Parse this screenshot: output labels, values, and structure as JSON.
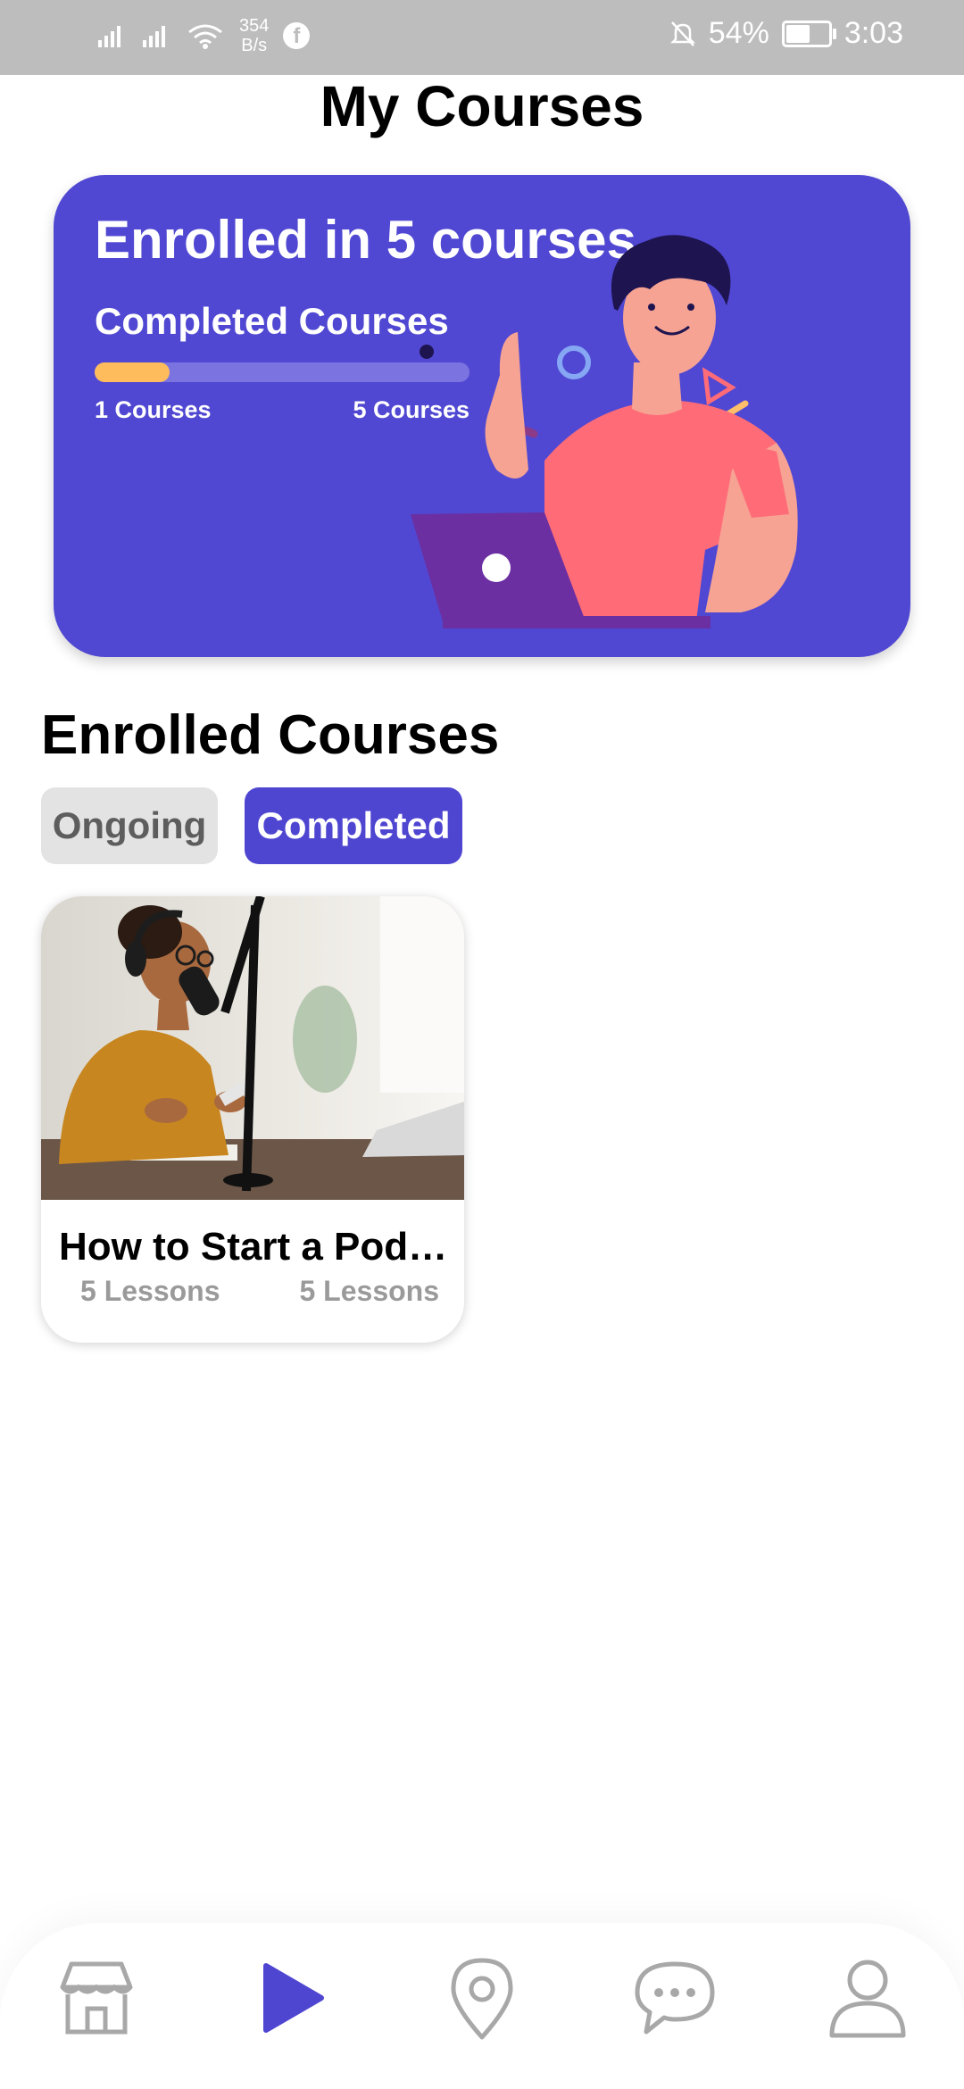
{
  "status_bar": {
    "net_speed_value": "354",
    "net_speed_unit": "B/s",
    "battery": "54%",
    "time": "3:03"
  },
  "page": {
    "title": "My Courses"
  },
  "hero": {
    "title": "Enrolled in 5 courses",
    "subtitle": "Completed Courses",
    "progress_fraction": 0.2,
    "progress_left_label": "1  Courses",
    "progress_right_label": "5 Courses",
    "accent": "#5048d2",
    "progress_color": "#ffbc5c"
  },
  "enrolled": {
    "title": "Enrolled Courses",
    "tabs": [
      {
        "label": "Ongoing",
        "selected": false
      },
      {
        "label": "Completed",
        "selected": true
      }
    ]
  },
  "courses": [
    {
      "title": "How to Start a Podc...",
      "lessons_left": "5 Lessons",
      "lessons_right": "5 Lessons"
    }
  ],
  "bottom_nav": {
    "items": [
      {
        "icon": "store-icon",
        "active": false
      },
      {
        "icon": "play-icon",
        "active": true
      },
      {
        "icon": "location-pin-icon",
        "active": false
      },
      {
        "icon": "chat-bubble-icon",
        "active": false
      },
      {
        "icon": "profile-icon",
        "active": false
      }
    ],
    "active_color": "#4e45d1",
    "inactive_color": "#a8a8a8"
  }
}
